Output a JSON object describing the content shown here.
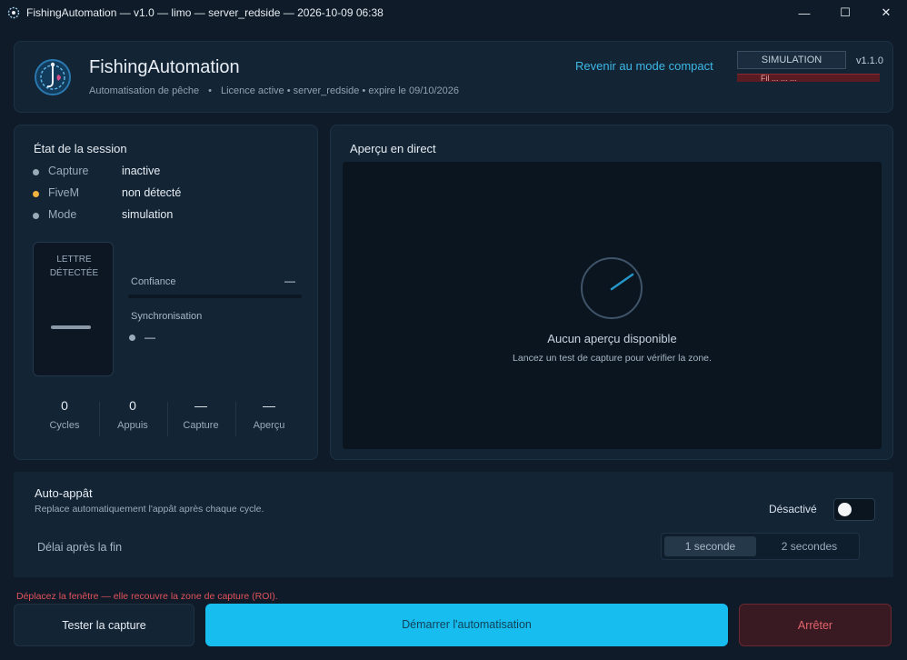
{
  "window": {
    "title": "FishingAutomation — v1.0 — limo — server_redside — 2026-10-09 06:38",
    "minimize": "—",
    "maximize": "☐",
    "close": "✕"
  },
  "header": {
    "app_name": "FishingAutomation",
    "subtitle_left": "Automatisation de pêche",
    "separator": "•",
    "subtitle_right": "Licence active • server_redside • expire le 09/10/2026",
    "compact_link": "Revenir au mode compact",
    "mode_badge": "SIMULATION",
    "alert_strip": "Fil ... ... ...",
    "version": "v1.1.0"
  },
  "session": {
    "title": "État de la session",
    "rows": [
      {
        "key": "Capture",
        "value": "inactive",
        "dot_color": "#9aa9b6"
      },
      {
        "key": "FiveM",
        "value": "non détecté",
        "dot_color": "#f0b340"
      },
      {
        "key": "Mode",
        "value": "simulation",
        "dot_color": "#9aa9b6"
      }
    ],
    "letter_label_1": "LETTRE",
    "letter_label_2": "DÉTECTÉE",
    "confidence_label": "Confiance",
    "confidence_value": "—",
    "confidence_fraction": 0,
    "sync_label": "Synchronisation",
    "sync_value": "—",
    "stats": [
      {
        "value": "0",
        "label": "Cycles"
      },
      {
        "value": "0",
        "label": "Appuis"
      },
      {
        "value": "—",
        "label": "Capture"
      },
      {
        "value": "—",
        "label": "Aperçu"
      }
    ]
  },
  "preview": {
    "title": "Aperçu en direct",
    "empty_title": "Aucun aperçu disponible",
    "empty_hint": "Lancez un test de capture pour vérifier la zone."
  },
  "auto_bait": {
    "title": "Auto-appât",
    "description": "Replace automatiquement l'appât après chaque cycle.",
    "state_label": "Désactivé",
    "enabled": false,
    "delay_label": "Délai après la fin",
    "delay_options": [
      "1 seconde",
      "2 secondes"
    ],
    "delay_selected": "1 seconde"
  },
  "roi_warning": "Déplacez la fenêtre — elle recouvre la zone de capture (ROI).",
  "actions": {
    "test": "Tester la capture",
    "start": "Démarrer l'automatisation",
    "stop": "Arrêter"
  },
  "colors": {
    "accent": "#16bdee",
    "danger": "#e3636b",
    "warning": "#f0b340",
    "background": "#0f1b28",
    "card": "#132435"
  }
}
